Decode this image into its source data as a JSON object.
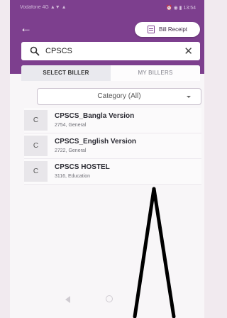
{
  "status_bar": {
    "carrier": "Vodafone 4G ▲▼ ▲",
    "right": "⏰ ◉ ▮ 13:54"
  },
  "header": {
    "back_icon": "arrow-left-icon",
    "bill_receipt_label": "Bill Receipt",
    "bill_receipt_icon": "receipt-icon"
  },
  "search": {
    "value": "CPSCS",
    "icon": "search-icon",
    "clear_icon": "close-icon"
  },
  "tabs": [
    {
      "label": "SELECT BILLER",
      "active": true
    },
    {
      "label": "MY BILLERS",
      "active": false
    }
  ],
  "category": {
    "selected": "Category (All)"
  },
  "billers": [
    {
      "initial": "C",
      "name": "CPSCS_Bangla Version",
      "detail": "2754, General"
    },
    {
      "initial": "C",
      "name": "CPSCS_English Version",
      "detail": "2722, General"
    },
    {
      "initial": "C",
      "name": "CPSCS HOSTEL",
      "detail": "3116, Education"
    }
  ],
  "colors": {
    "header_purple": "#7d3f8e",
    "annotation_arrow": "#000000"
  }
}
